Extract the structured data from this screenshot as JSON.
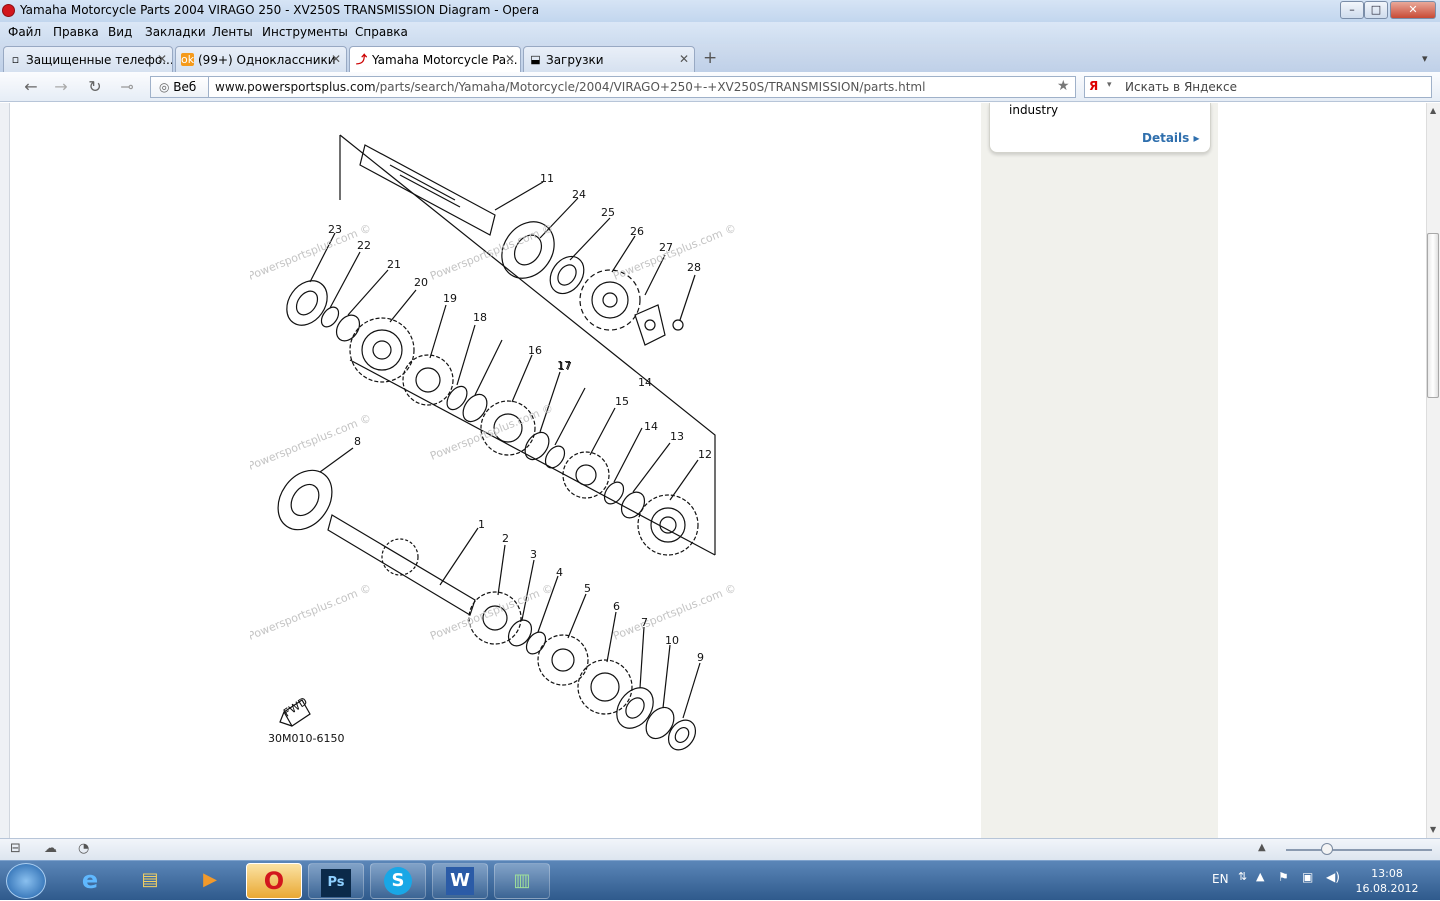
{
  "window": {
    "title": "Yamaha Motorcycle Parts 2004 VIRAGO 250 - XV250S TRANSMISSION Diagram - Opera",
    "controls": {
      "minimize": "–",
      "maximize": "□",
      "close": "✕"
    }
  },
  "menu": [
    "Файл",
    "Правка",
    "Вид",
    "Закладки",
    "Ленты",
    "Инструменты",
    "Справка"
  ],
  "tabs": [
    {
      "label": "Защищенные телефо...",
      "icon": "page-icon",
      "active": false
    },
    {
      "label": "(99+) Одноклассники",
      "icon": "ok-icon",
      "active": false
    },
    {
      "label": "Yamaha Motorcycle Pa...",
      "icon": "site-icon",
      "active": true
    },
    {
      "label": "Загрузки",
      "icon": "download-icon",
      "active": false
    }
  ],
  "tab_close_glyph": "✕",
  "new_tab_glyph": "+",
  "nav": {
    "web_badge": "Веб",
    "url_host": "www.powersportsplus.com",
    "url_path": "/parts/search/Yamaha/Motorcycle/2004/VIRAGO+250+-+XV250S/TRANSMISSION/parts.html",
    "search_placeholder": "Искать в Яндексе",
    "search_logo": "Я"
  },
  "sidebar_card": {
    "text": "industry",
    "link": "Details",
    "link_arrow": "▸"
  },
  "diagram": {
    "watermark": "Powersportsplus.com ©",
    "code": "30M010-6150",
    "fwd": "FWD",
    "labels": [
      "1",
      "2",
      "3",
      "4",
      "5",
      "6",
      "7",
      "8",
      "9",
      "10",
      "11",
      "12",
      "13",
      "14",
      "14",
      "15",
      "16",
      "17",
      "17",
      "18",
      "19",
      "20",
      "21",
      "22",
      "23",
      "24",
      "25",
      "26",
      "27",
      "28"
    ]
  },
  "taskbar": {
    "lang": "EN",
    "time": "13:08",
    "date": "16.08.2012",
    "apps": [
      "start-orb",
      "ie-icon",
      "explorer-icon",
      "media-icon",
      "opera-icon",
      "photoshop-icon",
      "skype-icon",
      "word-icon",
      "app-icon"
    ],
    "app_glyphs": {
      "opera": "O",
      "photoshop": "Ps",
      "skype": "S",
      "word": "W"
    }
  }
}
